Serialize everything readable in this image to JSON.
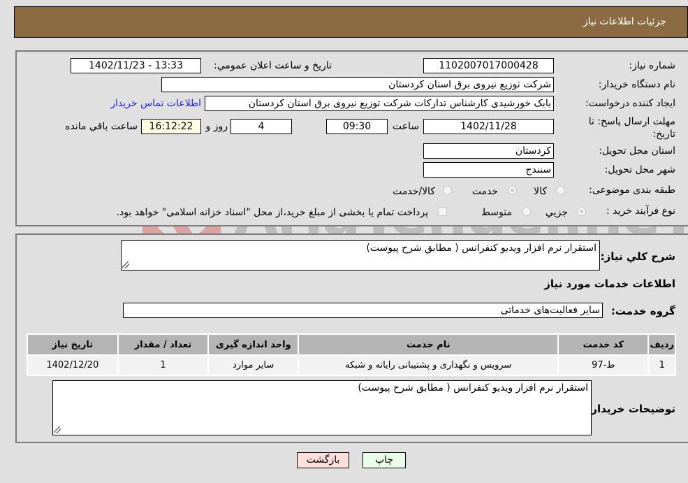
{
  "header": {
    "title": "جزئیات اطلاعات نیاز"
  },
  "form": {
    "need_number_label": "شماره نیاز:",
    "need_number": "1102007017000428",
    "announce_label": "تاریخ و ساعت اعلان عمومي:",
    "announce_value": "1402/11/23 - 13:33",
    "buyer_org_label": "نام دستگاه خریدار:",
    "buyer_org": "شرکت توزیع نیروی برق استان کردستان",
    "creator_label": "ایجاد کننده درخواست:",
    "creator": "بابک خورشیدی کارشناس تدارکات شرکت توزیع نیروی برق استان کردستان",
    "contact_link": "اطلاعات تماس خریدار",
    "deadline_label": "مهلت ارسال پاسخ: تا تاریخ:",
    "deadline_date": "1402/11/28",
    "time_label": "ساعت",
    "deadline_time": "09:30",
    "days_value": "4",
    "days_label": "روز و",
    "remaining_time": "16:12:22",
    "remaining_label": "ساعت باقي مانده",
    "province_label": "استان محل تحویل:",
    "province": "کردستان",
    "city_label": "شهر محل تحویل:",
    "city": "سنندج",
    "category_label": "طبقه بندی موضوعی:",
    "category_options": [
      "کالا",
      "خدمت",
      "کالا/خدمت"
    ],
    "category_selected": "خدمت",
    "process_label": "نوع فرآیند خرید :",
    "process_options": [
      "جزيي",
      "متوسط"
    ],
    "process_selected": "جزيي",
    "payment_note": "پرداخت تمام یا بخشی از مبلغ خرید،از محل \"اسناد خزانه اسلامی\" خواهد بود."
  },
  "details": {
    "summary_label": "شرح کلي نياز:",
    "summary": "استقرار نرم افزار ویدیو کنفرانس ( مطابق شرح پیوست)",
    "services_heading": "اطلاعات خدمات مورد نیاز",
    "service_group_label": "گروه خدمت:",
    "service_group": "سایر فعالیت‌های خدماتی",
    "table": {
      "headers": [
        "ردیف",
        "کد خدمت",
        "نام خدمت",
        "واحد اندازه گیری",
        "تعداد / مقدار",
        "تاریخ نیاز"
      ],
      "rows": [
        [
          "1",
          "ط-97",
          "سرویس و نگهداری و پشتیبانی رایانه و شبکه",
          "سایر موارد",
          "1",
          "1402/12/20"
        ]
      ]
    },
    "buyer_notes_label": "توضیحات خریدار:",
    "buyer_notes": "استقرار نرم افزار ویدیو کنفرانس ( مطابق شرح پیوست)"
  },
  "buttons": {
    "print": "چاپ",
    "back": "بازگشت"
  },
  "watermark": {
    "text": "AriaTender.neT"
  },
  "colors": {
    "header_bg": "#8b6c42",
    "print_bg": "#eaffea",
    "back_bg": "#ffdede",
    "link": "#2222cc"
  }
}
